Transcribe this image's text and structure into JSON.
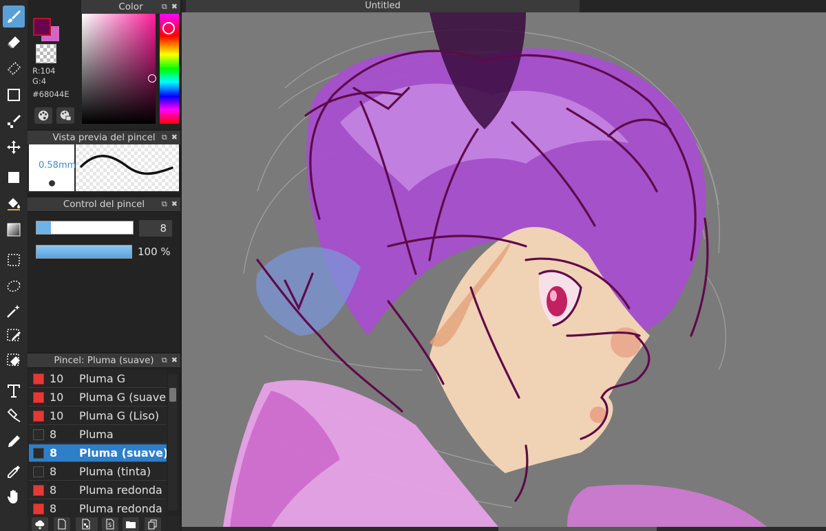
{
  "toolbar": {
    "tools": [
      {
        "name": "brush",
        "active": true
      },
      {
        "name": "eraser"
      },
      {
        "name": "dotted-eraser"
      },
      {
        "name": "rectangle"
      },
      {
        "name": "fill-brush"
      },
      {
        "name": "move"
      },
      {
        "name": "shape-fill"
      },
      {
        "name": "bucket"
      },
      {
        "name": "gradient"
      },
      {
        "name": "select-rect"
      },
      {
        "name": "lasso"
      },
      {
        "name": "magic-wand"
      },
      {
        "name": "select-pen"
      },
      {
        "name": "select-eraser"
      },
      {
        "name": "text"
      },
      {
        "name": "pen-vector"
      },
      {
        "name": "eyedropper-edit"
      },
      {
        "name": "eyedropper"
      },
      {
        "name": "hand"
      }
    ]
  },
  "color_panel": {
    "title": "Color",
    "fg_color": "#68044E",
    "bg_color": "#d067c6",
    "r_label": "R:104",
    "g_label": "G:4",
    "hex_label": "#68044E"
  },
  "preview_panel": {
    "title": "Vista previa del pincel",
    "size_label": "0.58mm"
  },
  "control_panel": {
    "title": "Control del pincel",
    "size_value": "8",
    "size_fraction": 0.15,
    "opacity_value": "100 %",
    "opacity_fraction": 1.0
  },
  "brush_list": {
    "title": "Pincel: Pluma (suave)",
    "rows": [
      {
        "size": "10",
        "name": "Pluma G",
        "color": "#e53935"
      },
      {
        "size": "10",
        "name": "Pluma G (suave)",
        "color": "#e53935"
      },
      {
        "size": "10",
        "name": "Pluma G (Liso)",
        "color": "#e53935"
      },
      {
        "size": "8",
        "name": "Pluma",
        "color": "#2a2a2a"
      },
      {
        "size": "8",
        "name": "Pluma (suave)",
        "color": "#2a2a2a",
        "selected": true
      },
      {
        "size": "8",
        "name": "Pluma (tinta)",
        "color": "#2a2a2a"
      },
      {
        "size": "8",
        "name": "Pluma redonda",
        "color": "#e53935"
      },
      {
        "size": "8",
        "name": "Pluma redonda",
        "color": "#e53935"
      }
    ]
  },
  "canvas": {
    "tab_title": "Untitled",
    "bg_color": "#7b7a7a"
  }
}
